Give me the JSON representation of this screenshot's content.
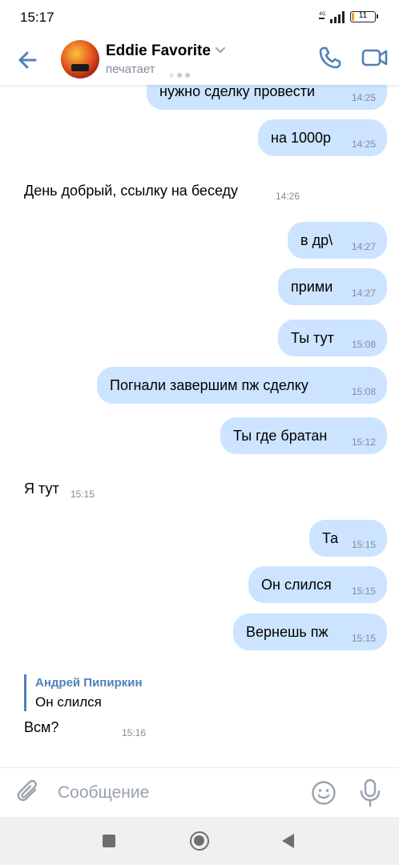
{
  "status_bar": {
    "time": "15:17",
    "battery": "11",
    "signal_label": "4G"
  },
  "header": {
    "contact_name": "Eddie Favorite",
    "contact_status": "печатает",
    "accent_color": "#5181b8"
  },
  "messages": [
    {
      "dir": "out",
      "text": "нужно сделку провести",
      "time": "14:25"
    },
    {
      "dir": "out",
      "text": "на 1000р",
      "time": "14:25"
    },
    {
      "dir": "in",
      "text": "День добрый, ссылку на беседу",
      "time": "14:26"
    },
    {
      "dir": "out",
      "text": "в др\\",
      "time": "14:27"
    },
    {
      "dir": "out",
      "text": "прими",
      "time": "14:27"
    },
    {
      "dir": "out",
      "text": "Ты тут",
      "time": "15:08"
    },
    {
      "dir": "out",
      "text": "Погнали завершим пж сделку",
      "time": "15:08"
    },
    {
      "dir": "out",
      "text": "Ты где братан",
      "time": "15:12"
    },
    {
      "dir": "in",
      "text": "Я тут",
      "time": "15:15"
    },
    {
      "dir": "out",
      "text": "Та",
      "time": "15:15"
    },
    {
      "dir": "out",
      "text": "Он слился",
      "time": "15:15"
    },
    {
      "dir": "out",
      "text": "Вернешь пж",
      "time": "15:15"
    },
    {
      "dir": "in",
      "text": "Всм?",
      "time": "15:16",
      "reply": {
        "author": "Андрей Пипиркин",
        "text": "Он слился"
      }
    }
  ],
  "composer": {
    "placeholder": "Сообщение"
  },
  "colors": {
    "outgoing_bubble": "#cce4ff",
    "secondary_text": "#818c99",
    "accent": "#5181b8"
  },
  "icons": {
    "back": "arrow-left-icon",
    "call": "phone-icon",
    "video": "video-camera-icon",
    "attach": "paperclip-icon",
    "emoji": "smiley-icon",
    "mic": "microphone-icon",
    "nav_recent": "square-icon",
    "nav_home": "circle-icon",
    "nav_back": "triangle-back-icon"
  }
}
